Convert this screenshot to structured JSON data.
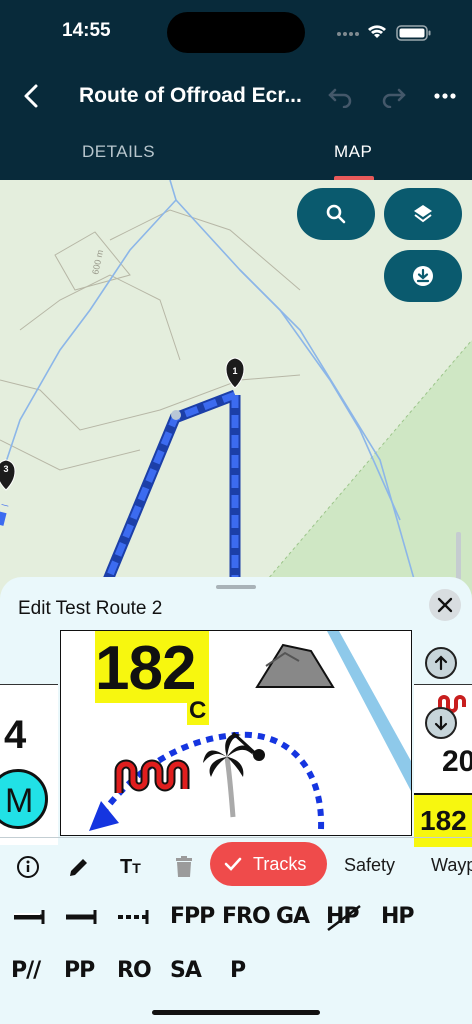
{
  "status_bar": {
    "time": "14:55"
  },
  "header": {
    "title": "Route of Offroad Ecr...",
    "tabs": [
      {
        "label": "DETAILS"
      },
      {
        "label": "MAP"
      }
    ],
    "active_tab": "MAP"
  },
  "map": {
    "contour_label": "600 m",
    "waypoints": [
      {
        "label": "1"
      },
      {
        "label": "3"
      }
    ],
    "route_color": "#2f5be8",
    "buttons": [
      "search-icon",
      "layers-icon",
      "download-icon"
    ]
  },
  "sheet": {
    "title": "Edit Test Route 2",
    "preview": {
      "number": "182",
      "letter": "C"
    },
    "left_panel": {
      "number": "4",
      "badge": "M"
    },
    "right_panel": {
      "number": "20",
      "bottom_number": "182"
    },
    "toolbar": {
      "icons": [
        "info-icon",
        "pencil-icon",
        "text-size-icon",
        "trash-icon"
      ],
      "chips": [
        {
          "label": "Tracks",
          "selected": true
        },
        {
          "label": "Safety",
          "selected": false
        },
        {
          "label": "Wayp",
          "selected": false
        }
      ]
    },
    "symbols_row1": [
      "FPP",
      "FRO",
      "GA",
      "HP",
      "HP"
    ],
    "symbols_row2": [
      "P//",
      "PP",
      "RO",
      "SA",
      "P"
    ]
  },
  "colors": {
    "header_bg": "#082a3a",
    "accent": "#ef4b4b",
    "map_button": "#0a5a6e",
    "sheet_bg": "#eaf8fb"
  }
}
